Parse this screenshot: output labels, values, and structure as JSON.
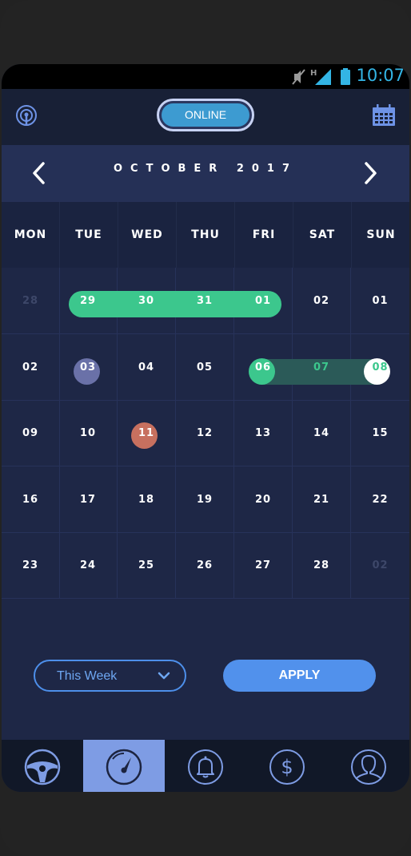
{
  "status_bar": {
    "time": "10:07",
    "network_label": "H"
  },
  "header": {
    "status_pill": "ONLINE"
  },
  "calendar": {
    "month_label": "OCTOBER 2017",
    "weekdays": [
      "MON",
      "TUE",
      "WED",
      "THU",
      "FRI",
      "SAT",
      "SUN"
    ],
    "weeks": [
      [
        "28",
        "29",
        "30",
        "31",
        "01",
        "02",
        "01"
      ],
      [
        "02",
        "03",
        "04",
        "05",
        "06",
        "07",
        "08"
      ],
      [
        "09",
        "10",
        "11",
        "12",
        "13",
        "14",
        "15"
      ],
      [
        "16",
        "17",
        "18",
        "19",
        "20",
        "21",
        "22"
      ],
      [
        "23",
        "24",
        "25",
        "26",
        "27",
        "28",
        "02"
      ]
    ]
  },
  "controls": {
    "period_select_value": "This Week",
    "apply_label": "APPLY"
  },
  "icons": {
    "header_left": "broadcast-icon",
    "header_right": "calendar-icon",
    "tabs": [
      "steering-wheel-icon",
      "speedometer-icon",
      "bell-icon",
      "dollar-icon",
      "user-icon"
    ]
  },
  "colors": {
    "accent_blue": "#5191ec",
    "range_green": "#3cc78d",
    "highlight_purple": "#6a71a8",
    "highlight_red": "#c7705f",
    "active_tab": "#7e9ce4"
  }
}
